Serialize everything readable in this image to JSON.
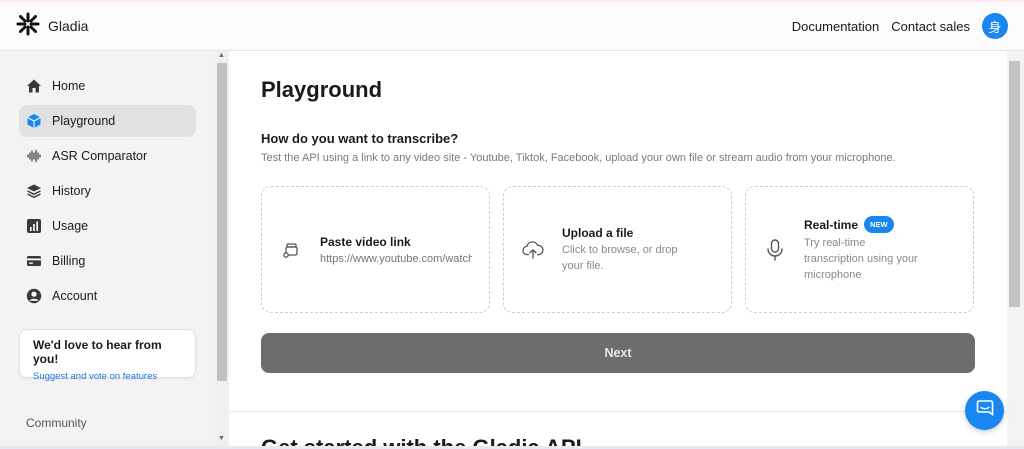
{
  "brand": {
    "name": "Gladia"
  },
  "header": {
    "documentation": "Documentation",
    "contact_sales": "Contact sales",
    "avatar_initial": "身"
  },
  "sidebar": {
    "items": [
      {
        "label": "Home",
        "icon": "home-icon",
        "active": false
      },
      {
        "label": "Playground",
        "icon": "cube-icon",
        "active": true
      },
      {
        "label": "ASR Comparator",
        "icon": "waveform-icon",
        "active": false
      },
      {
        "label": "History",
        "icon": "layers-icon",
        "active": false
      },
      {
        "label": "Usage",
        "icon": "bar-chart-icon",
        "active": false
      },
      {
        "label": "Billing",
        "icon": "credit-card-icon",
        "active": false
      },
      {
        "label": "Account",
        "icon": "user-circle-icon",
        "active": false
      }
    ],
    "feedback": {
      "title": "We'd love to hear from you!",
      "link": "Suggest and vote on features"
    },
    "community": "Community"
  },
  "main": {
    "title": "Playground",
    "question": "How do you want to transcribe?",
    "subtitle": "Test the API using a link to any video site - Youtube, Tiktok, Facebook, upload your own file or stream audio from your microphone.",
    "cards": {
      "link": {
        "title": "Paste video link",
        "placeholder": "https://www.youtube.com/watch?v="
      },
      "upload": {
        "title": "Upload a file",
        "desc_line1": "Click to browse, or drop",
        "desc_line2": "your file."
      },
      "realtime": {
        "title": "Real-time",
        "badge": "NEW",
        "desc_line1": "Try real-time",
        "desc_line2": "transcription using your",
        "desc_line3": "microphone"
      }
    },
    "next_label": "Next",
    "next_section_heading": "Get started with the Gladia API"
  },
  "colors": {
    "accent": "#1a86f0",
    "next_button": "#6d6d6d",
    "link": "#1a7ae6"
  }
}
